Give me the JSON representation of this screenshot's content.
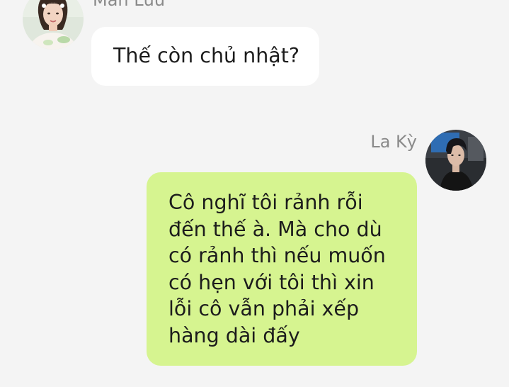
{
  "messages": [
    {
      "sender": "Mẫn Lưu",
      "side": "left",
      "text": "Thế còn chủ nhật?",
      "avatar": "woman-portrait-avatar",
      "bubble_color": "#ffffff"
    },
    {
      "sender": "La Kỳ",
      "side": "right",
      "lines": [
        "Cô nghĩ tôi rảnh rỗi",
        "đến thế à. Mà cho dù",
        "có rảnh thì nếu muốn",
        "có hẹn với tôi thì xin",
        "lỗi cô vẫn phải xếp",
        "hàng dài đấy"
      ],
      "avatar": "man-portrait-avatar",
      "bubble_color": "#d6f490"
    }
  ],
  "colors": {
    "background": "#f4f4f4",
    "sender_name": "#8a8a8a",
    "text": "#1c1c1c"
  }
}
